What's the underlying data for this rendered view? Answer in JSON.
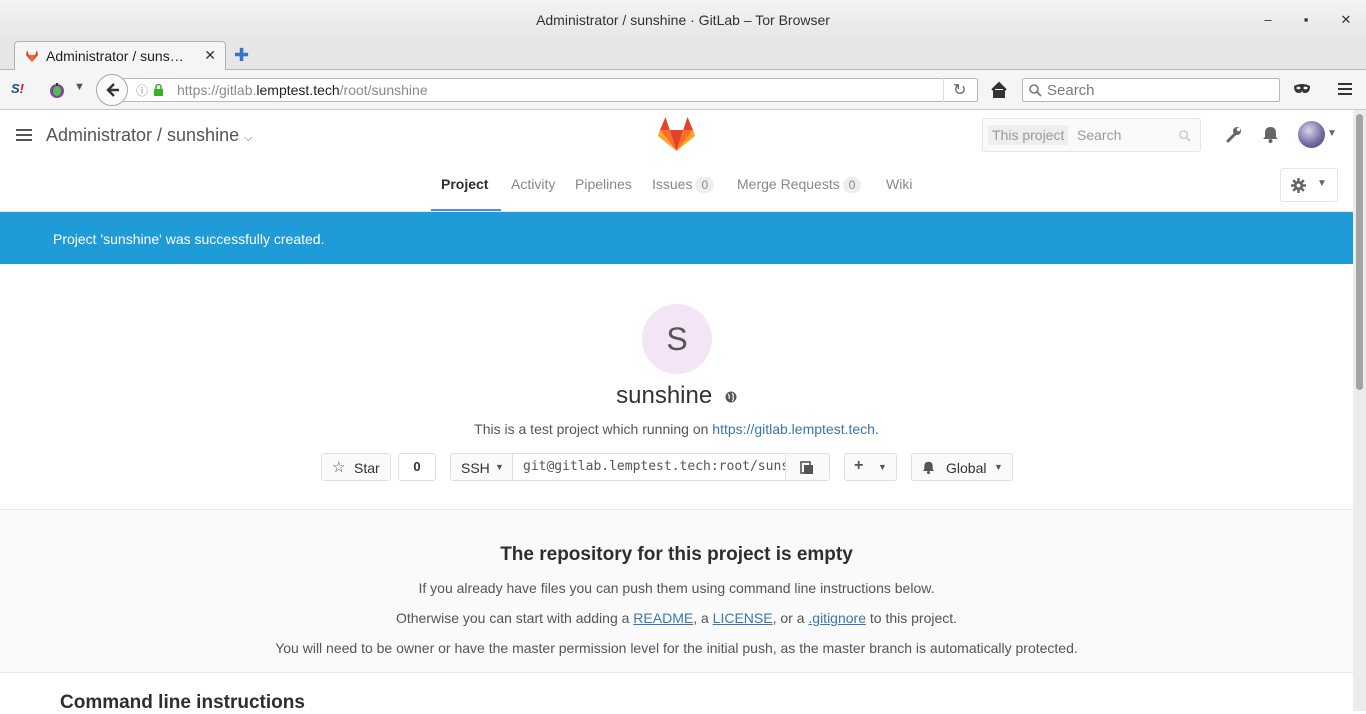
{
  "window": {
    "title": "Administrator / sunshine · GitLab – Tor Browser"
  },
  "tab": {
    "title": "Administrator / suns…"
  },
  "navbar": {
    "url_prefix": "https://gitlab.",
    "url_domain": "lemptest.tech",
    "url_path": "/root/sunshine",
    "search_placeholder": "Search"
  },
  "gitlab_header": {
    "breadcrumb": "Administrator / sunshine",
    "search_scope": "This project",
    "search_placeholder": "Search"
  },
  "project_nav": {
    "items": [
      {
        "label": "Project",
        "active": true
      },
      {
        "label": "Activity"
      },
      {
        "label": "Pipelines"
      },
      {
        "label": "Issues",
        "count": "0"
      },
      {
        "label": "Merge Requests",
        "count": "0"
      },
      {
        "label": "Wiki"
      }
    ]
  },
  "flash": {
    "message": "Project 'sunshine' was successfully created."
  },
  "project": {
    "avatar_letter": "S",
    "name": "sunshine",
    "description_prefix": "This is a test project which running on ",
    "description_link": "https://gitlab.lemptest.tech",
    "description_suffix": ".",
    "star_label": "Star",
    "star_count": "0",
    "protocol": "SSH",
    "clone_url": "git@gitlab.lemptest.tech:root/sunshine.git",
    "notification_level": "Global"
  },
  "empty_repo": {
    "title": "The repository for this project is empty",
    "line1": "If you already have files you can push them using command line instructions below.",
    "line2_prefix": "Otherwise you can start with adding a ",
    "readme": "README",
    "sep1": ", a ",
    "license": "LICENSE",
    "sep2": ", or a ",
    "gitignore": ".gitignore",
    "line2_suffix": " to this project.",
    "line3": "You will need to be owner or have the master permission level for the initial push, as the master branch is automatically protected."
  },
  "command_line": {
    "title": "Command line instructions"
  },
  "colors": {
    "flash_bg": "#1f9bd8",
    "link": "#3777b0",
    "active_tab": "#4a8bee"
  }
}
